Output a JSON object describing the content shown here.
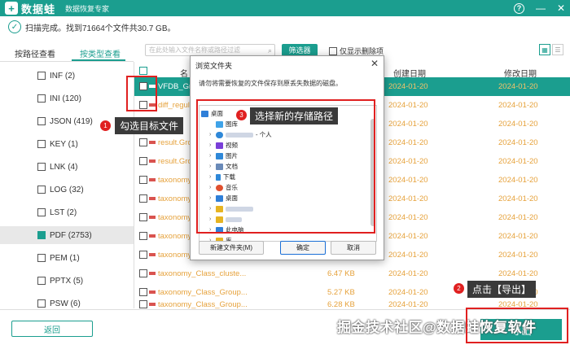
{
  "titlebar": {
    "logo_char": "+",
    "app_name": "数据蛙",
    "subtitle": "数据恢复专家",
    "help": "?",
    "minimize": "—",
    "close": "✕"
  },
  "status": {
    "check": "✓",
    "text": "扫描完成。找到71664个文件共30.7 GB。"
  },
  "tabs": [
    {
      "label": "按路径查看"
    },
    {
      "label": "按类型查看"
    }
  ],
  "search": {
    "placeholder": "在此处输入文件名称或路径过滤"
  },
  "toolbar": {
    "filter_label": "筛选器",
    "only_deleted": "仅显示删除项"
  },
  "sidebar": {
    "items": [
      {
        "label": "INF (2)"
      },
      {
        "label": "INI (120)"
      },
      {
        "label": "JSON (419)"
      },
      {
        "label": "KEY (1)"
      },
      {
        "label": "LNK (4)"
      },
      {
        "label": "LOG (32)"
      },
      {
        "label": "LST (2)"
      },
      {
        "label": "PDF (2753)"
      },
      {
        "label": "PEM (1)"
      },
      {
        "label": "PPTX (5)"
      },
      {
        "label": "PSW (6)"
      }
    ]
  },
  "table": {
    "headers": {
      "name": "名",
      "created": "创建日期",
      "modified": "修改日期"
    },
    "rows": [
      {
        "name": "VFDB_Gro",
        "size": "",
        "created": "2024-01-20",
        "modified": "2024-01-20"
      },
      {
        "name": "diff_regula",
        "size": "",
        "created": "2024-01-20",
        "modified": "2024-01-20"
      },
      {
        "name": "",
        "size": "",
        "created": "2024-01-20",
        "modified": "2024-01-20"
      },
      {
        "name": "result.Gro",
        "size": "",
        "created": "2024-01-20",
        "modified": "2024-01-20"
      },
      {
        "name": "result.Gro",
        "size": "",
        "created": "2024-01-20",
        "modified": "2024-01-20"
      },
      {
        "name": "taxonomy_",
        "size": "",
        "created": "2024-01-20",
        "modified": "2024-01-20"
      },
      {
        "name": "taxonomy_",
        "size": "",
        "created": "2024-01-20",
        "modified": "2024-01-20"
      },
      {
        "name": "taxonomy_",
        "size": "",
        "created": "2024-01-20",
        "modified": "2024-01-20"
      },
      {
        "name": "taxonomy_",
        "size": "",
        "created": "2024-01-20",
        "modified": "2024-01-20"
      },
      {
        "name": "taxonomy_",
        "size": "",
        "created": "2024-01-20",
        "modified": "2024-01-20"
      },
      {
        "name": "taxonomy_Class_cluste...",
        "size": "6.47 KB",
        "created": "2024-01-20",
        "modified": "2024-01-20"
      },
      {
        "name": "taxonomy_Class_Group...",
        "size": "5.27 KB",
        "created": "2024-01-20",
        "modified": "2024-01-20"
      },
      {
        "name": "taxonomy_Class_Group...",
        "size": "6.28 KB",
        "created": "2024-01-20",
        "modified": "2024-01-20"
      }
    ]
  },
  "bottom": {
    "back_label": "返回",
    "export_label": "导出"
  },
  "watermark": "掘金技术社区@数据蛙恢复软件",
  "dialog": {
    "title": "浏览文件夹",
    "close": "✕",
    "message": "请勿将需要恢复的文件保存到原丢失数据的磁盘。",
    "tree": [
      {
        "label": "桌面",
        "level": 0,
        "color": "#2f7fd8"
      },
      {
        "label": "图库",
        "level": 1,
        "color": "#3fa3e8"
      },
      {
        "label": "- 个人",
        "level": 1,
        "color": "#2f88d8"
      },
      {
        "label": "视频",
        "level": 1,
        "color": "#7a3fd8"
      },
      {
        "label": "图片",
        "level": 1,
        "color": "#2f88d8"
      },
      {
        "label": "文档",
        "level": 1,
        "color": "#6a8ab8"
      },
      {
        "label": "下载",
        "level": 1,
        "color": "#2f88d8"
      },
      {
        "label": "音乐",
        "level": 1,
        "color": "#e0502f"
      },
      {
        "label": "桌面",
        "level": 1,
        "color": "#2f7fd8"
      },
      {
        "label": "",
        "level": 1,
        "color": "#e6b422"
      },
      {
        "label": "",
        "level": 1,
        "color": "#e6b422"
      },
      {
        "label": "此电脑",
        "level": 1,
        "color": "#2f7fd8"
      },
      {
        "label": "库",
        "level": 1,
        "color": "#e6b422"
      }
    ],
    "new_folder": "新建文件夹(M)",
    "ok": "确定",
    "cancel": "取消"
  },
  "annotations": [
    {
      "num": "1",
      "text": "勾选目标文件"
    },
    {
      "num": "3",
      "text": "选择新的存储路径"
    },
    {
      "num": "2",
      "text": "点击【导出】"
    }
  ]
}
